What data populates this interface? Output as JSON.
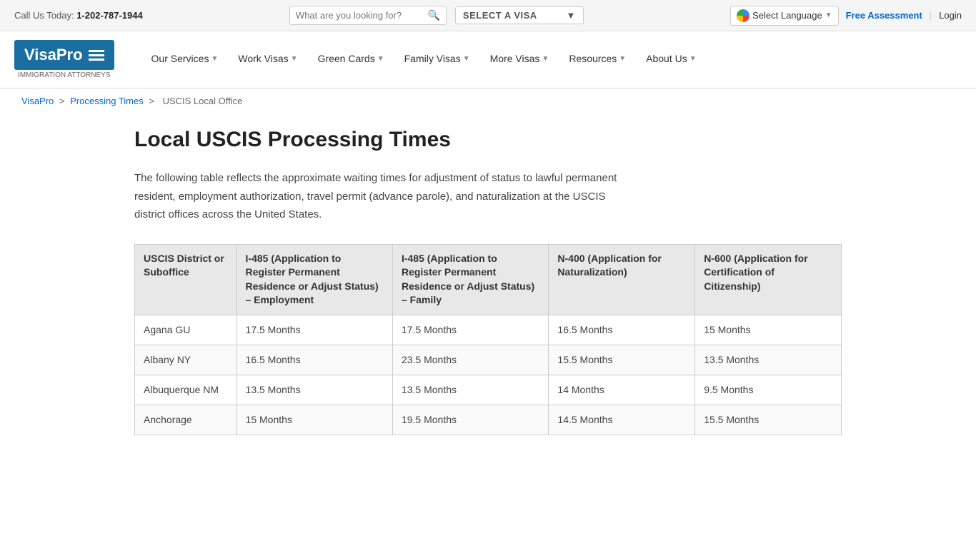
{
  "topbar": {
    "call_label": "Call Us Today:",
    "phone": "1-202-787-1944",
    "search_placeholder": "What are you looking for?",
    "visa_select_label": "SELECT A VISA",
    "translate_label": "Select Language",
    "free_assessment": "Free Assessment",
    "login": "Login"
  },
  "nav": {
    "logo_text": "VisaPro",
    "logo_sub": "IMMIGRATION ATTORNEYS",
    "items": [
      {
        "label": "Our Services",
        "has_dropdown": true
      },
      {
        "label": "Work Visas",
        "has_dropdown": true
      },
      {
        "label": "Green Cards",
        "has_dropdown": true
      },
      {
        "label": "Family Visas",
        "has_dropdown": true
      },
      {
        "label": "More Visas",
        "has_dropdown": true
      },
      {
        "label": "Resources",
        "has_dropdown": true
      },
      {
        "label": "About Us",
        "has_dropdown": true
      }
    ]
  },
  "breadcrumb": {
    "items": [
      {
        "label": "VisaPro",
        "href": "#"
      },
      {
        "label": "Processing Times",
        "href": "#"
      },
      {
        "label": "USCIS Local Office",
        "href": null
      }
    ]
  },
  "page": {
    "title": "Local USCIS Processing Times",
    "description": "The following table reflects the approximate waiting times for adjustment of status to lawful permanent resident, employment authorization, travel permit (advance parole), and naturalization at the USCIS district offices across the United States."
  },
  "table": {
    "headers": [
      "USCIS District or Suboffice",
      "I-485 (Application to Register Permanent Residence or Adjust Status) – Employment",
      "I-485 (Application to Register Permanent Residence or Adjust Status) – Family",
      "N-400 (Application for Naturalization)",
      "N-600 (Application for Certification of Citizenship)"
    ],
    "rows": [
      [
        "Agana GU",
        "17.5 Months",
        "17.5 Months",
        "16.5 Months",
        "15 Months"
      ],
      [
        "Albany NY",
        "16.5 Months",
        "23.5 Months",
        "15.5 Months",
        "13.5 Months"
      ],
      [
        "Albuquerque NM",
        "13.5 Months",
        "13.5 Months",
        "14 Months",
        "9.5 Months"
      ],
      [
        "Anchorage",
        "15 Months",
        "19.5 Months",
        "14.5 Months",
        "15.5 Months"
      ]
    ]
  }
}
